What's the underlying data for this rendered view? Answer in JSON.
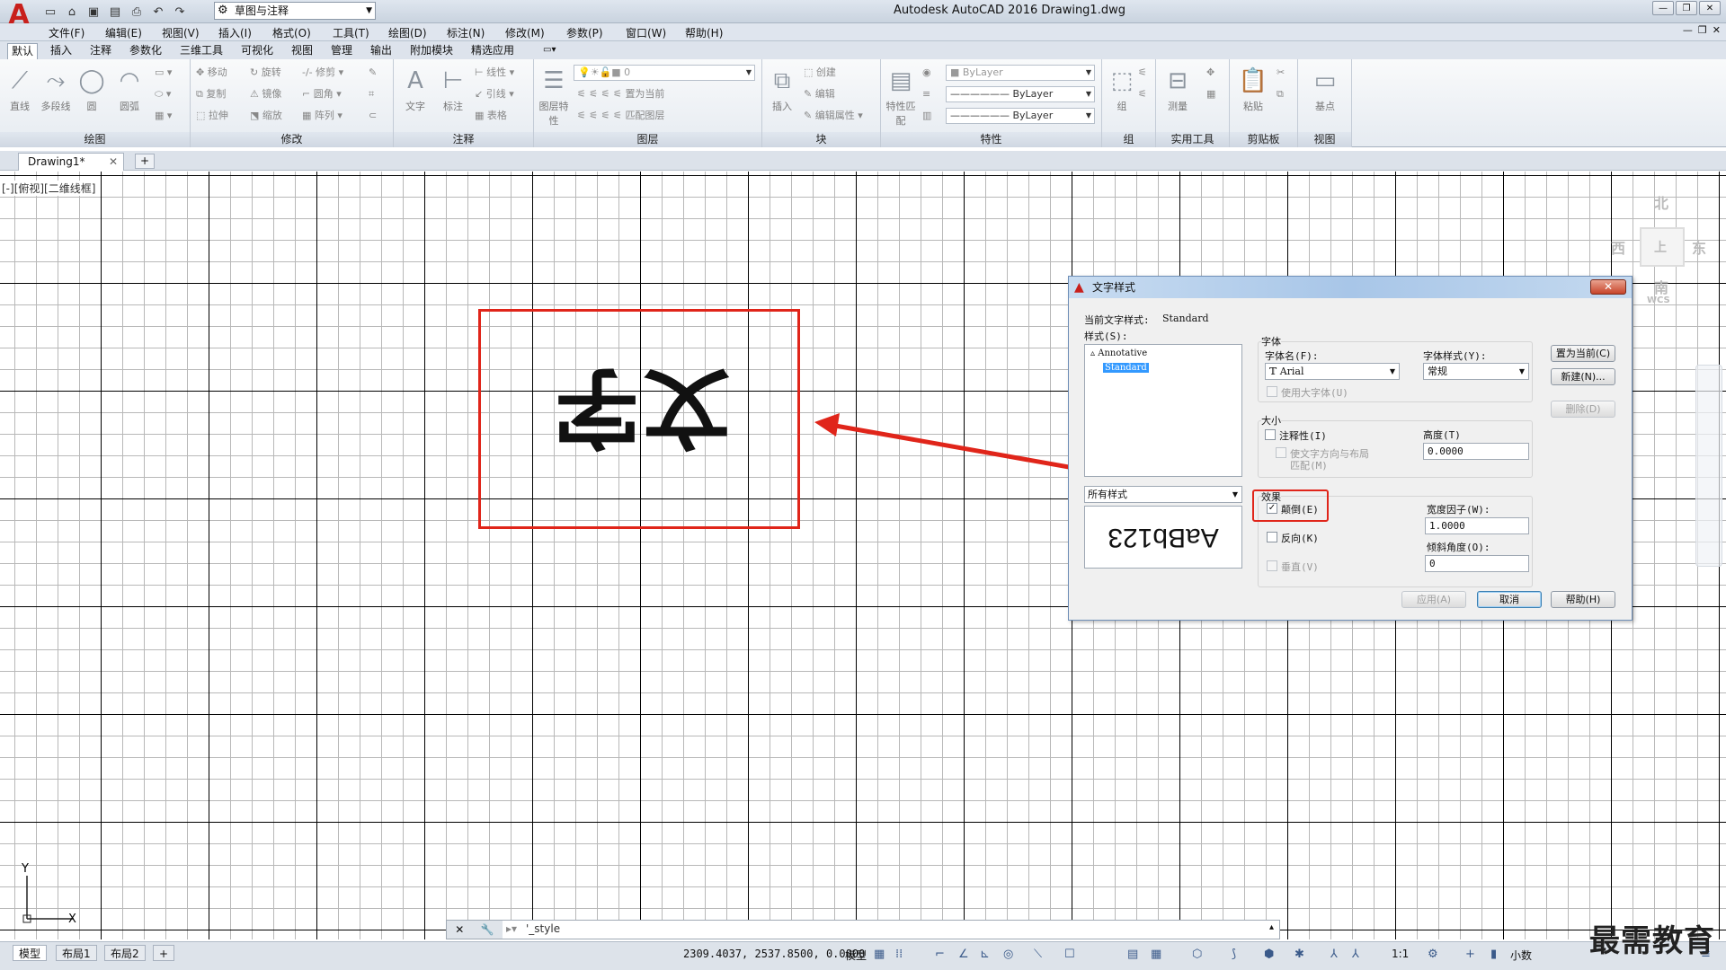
{
  "titlebar": {
    "title": "Autodesk AutoCAD 2016    Drawing1.dwg",
    "workspace": "草图与注释",
    "app_logo": "A"
  },
  "menu": [
    "文件(F)",
    "编辑(E)",
    "视图(V)",
    "插入(I)",
    "格式(O)",
    "工具(T)",
    "绘图(D)",
    "标注(N)",
    "修改(M)",
    "参数(P)",
    "窗口(W)",
    "帮助(H)"
  ],
  "ribbon_tabs": [
    "默认",
    "插入",
    "注释",
    "参数化",
    "三维工具",
    "可视化",
    "视图",
    "管理",
    "输出",
    "附加模块",
    "精选应用"
  ],
  "panels": {
    "draw": {
      "title": "绘图",
      "tools": [
        "直线",
        "多段线",
        "圆",
        "圆弧"
      ]
    },
    "modify": {
      "title": "修改",
      "tools": [
        "移动",
        "旋转",
        "修剪",
        "复制",
        "镜像",
        "圆角",
        "拉伸",
        "缩放",
        "阵列"
      ]
    },
    "annotation": {
      "title": "注释",
      "tools": [
        "文字",
        "标注",
        "线性",
        "引线",
        "表格"
      ]
    },
    "layers": {
      "title": "图层",
      "tools": [
        "图层特性",
        "置为当前",
        "匹配图层"
      ],
      "current_layer": "0"
    },
    "block": {
      "title": "块",
      "tools": [
        "插入",
        "创建",
        "编辑",
        "编辑属性"
      ]
    },
    "properties": {
      "title": "特性",
      "tools": [
        "特性匹配"
      ],
      "combos": [
        "ByLayer",
        "ByLayer",
        "ByLayer"
      ]
    },
    "groups": {
      "title": "组",
      "tools": [
        "组"
      ]
    },
    "utilities": {
      "title": "实用工具",
      "tools": [
        "测量"
      ]
    },
    "clipboard": {
      "title": "剪贴板",
      "tools": [
        "粘贴"
      ]
    },
    "view": {
      "title": "视图",
      "tools": [
        "基点"
      ]
    }
  },
  "doc_tab": {
    "name": "Drawing1*"
  },
  "viewport": {
    "label": "[-][俯视][二维线框]",
    "viewcube": {
      "north": "北",
      "south": "南",
      "east": "东",
      "west": "西",
      "top": "上",
      "wcs": "WCS"
    },
    "ucs_x": "X",
    "ucs_y": "Y"
  },
  "drawing_text": "文字",
  "dialog": {
    "title": "文字样式",
    "current_style_label": "当前文字样式:",
    "current_style_value": "Standard",
    "styles_label": "样式(S):",
    "styles": [
      "Annotative",
      "Standard"
    ],
    "selected_style": "Standard",
    "filter": "所有样式",
    "preview_text": "AaBb123",
    "font_section": "字体",
    "font_name_label": "字体名(F):",
    "font_name": "Arial",
    "font_style_label": "字体样式(Y):",
    "font_style": "常规",
    "bigfont_label": "使用大字体(U)",
    "size_section": "大小",
    "annotative_label": "注释性(I)",
    "match_layout_label_1": "使文字方向与布局",
    "match_layout_label_2": "匹配(M)",
    "height_label": "高度(T)",
    "height": "0.0000",
    "effects_section": "效果",
    "upside_down_label": "颠倒(E)",
    "upside_down_checked": true,
    "backwards_label": "反向(K)",
    "vertical_label": "垂直(V)",
    "width_factor_label": "宽度因子(W):",
    "width_factor": "1.0000",
    "oblique_label": "倾斜角度(O):",
    "oblique": "0",
    "btn_set_current": "置为当前(C)",
    "btn_new": "新建(N)...",
    "btn_delete": "删除(D)",
    "btn_apply": "应用(A)",
    "btn_cancel": "取消",
    "btn_help": "帮助(H)",
    "close_glyph": "✕"
  },
  "command_line": {
    "text": "'_style"
  },
  "status": {
    "layout_tabs": [
      "模型",
      "布局1",
      "布局2"
    ],
    "coords": "2309.4037, 2537.8500, 0.0000",
    "mode": "模型",
    "scale": "1:1",
    "units": "小数"
  },
  "watermark": "最需教育",
  "colors": {
    "highlight_red": "#e0251a",
    "selection_blue": "#3399ff",
    "autocad_red": "#c8201c"
  }
}
